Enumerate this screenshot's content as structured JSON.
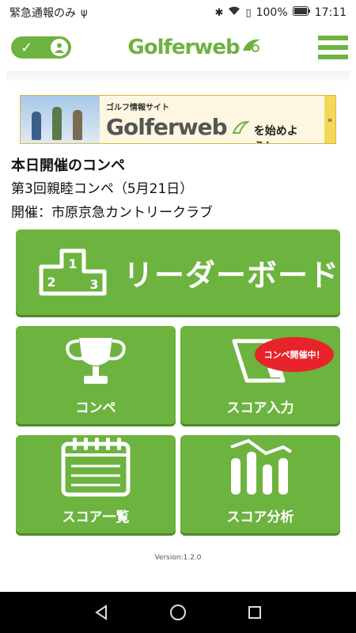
{
  "status": {
    "left_text": "緊急通報のみ",
    "battery": "100%",
    "time": "17:11"
  },
  "header": {
    "logo": "Golferweb",
    "login_state": "logged-in"
  },
  "banner": {
    "subtitle": "ゴルフ情報サイト",
    "logo": "Golferweb",
    "cta": "を始めよう！",
    "arrow": "»"
  },
  "info": {
    "title": "本日開催のコンペ",
    "compe_name": "第3回親睦コンペ（5月21日）",
    "venue": "開催：市原京急カントリークラブ"
  },
  "tiles": {
    "leaderboard": "リーダーボード",
    "podium": [
      "1",
      "2",
      "3"
    ],
    "compe": "コンペ",
    "score_input": "スコア入力",
    "score_input_badge": "コンペ開催中！",
    "score_list": "スコア一覧",
    "score_analysis": "スコア分析"
  },
  "footer": {
    "version": "Version:1.2.0"
  },
  "colors": {
    "brand_green": "#6db33f",
    "badge_red": "#e8232a"
  }
}
